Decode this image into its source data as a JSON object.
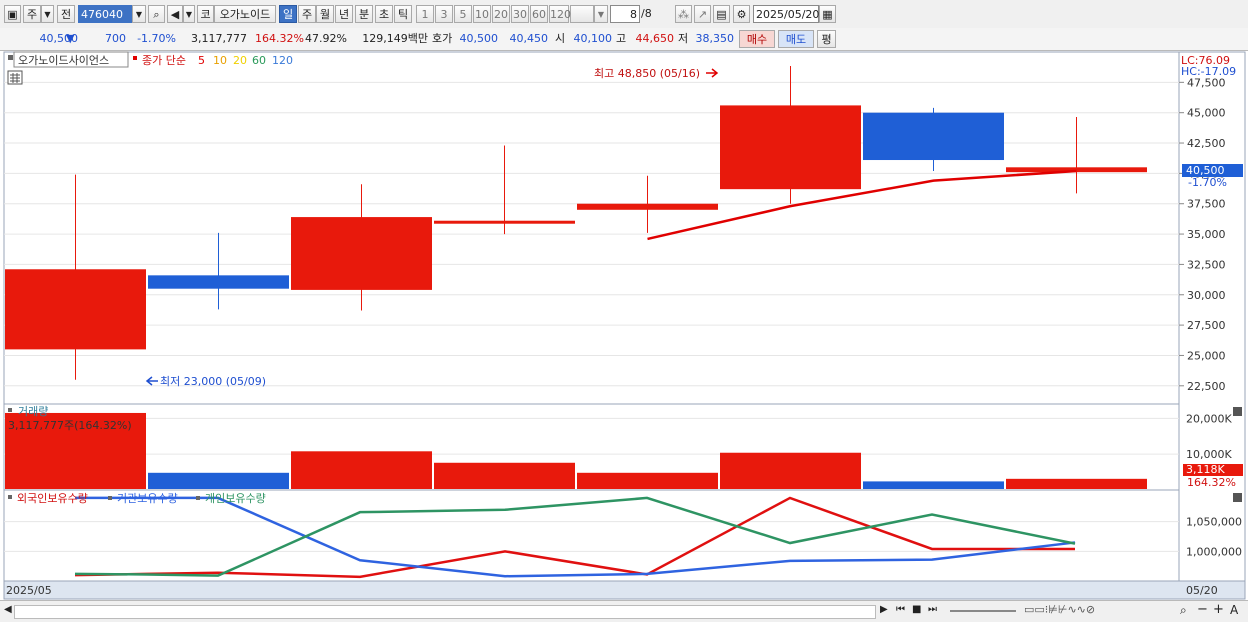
{
  "toolbar": {
    "market_label": "주",
    "prev_label": "전",
    "stock_code": "476040",
    "type_label": "코",
    "stock_name": "오가노이드",
    "periods": [
      "일",
      "주",
      "월",
      "년",
      "분",
      "초",
      "틱"
    ],
    "active_period": "일",
    "intervals": [
      "1",
      "3",
      "5",
      "10",
      "20",
      "30",
      "60",
      "120"
    ],
    "count_value": "8",
    "count_total": "/8",
    "date": "2025/05/20"
  },
  "quote": {
    "price": "40,500",
    "change": "700",
    "change_pct": "-1.70%",
    "volume": "3,117,777",
    "volume_ratio": "164.32%",
    "turnover": "47.92%",
    "amount": "129,149백만",
    "ask_label": "호가",
    "ask": "40,500",
    "bid": "40,450",
    "open_label": "시",
    "open": "40,100",
    "high_label": "고",
    "high": "44,650",
    "low_label": "저",
    "low": "38,350",
    "buy_label": "매수",
    "sell_label": "매도",
    "eval_label": "평"
  },
  "legend": {
    "name": "오가노이드사이언스",
    "ma_prefix": "종가 단순",
    "ma": [
      {
        "label": "5",
        "color": "#e00000"
      },
      {
        "label": "10",
        "color": "#e8a000"
      },
      {
        "label": "20",
        "color": "#f0d000"
      },
      {
        "label": "60",
        "color": "#2a9a5a"
      },
      {
        "label": "120",
        "color": "#3a7ad8"
      }
    ]
  },
  "price_panel": {
    "lc": "LC:76.09",
    "hc": "HC:-17.09",
    "current_price": "40,500",
    "current_pct": "-1.70%",
    "high_note": "최고 48,850 (05/16)",
    "low_note": "최저 23,000 (05/09)"
  },
  "volume_panel": {
    "title": "거래량",
    "note": "3,117,777주(164.32%)",
    "current": "3,118K",
    "current_pct": "164.32%"
  },
  "holdings_panel": {
    "series_labels": [
      "외국인보유수량",
      "기관보유수량",
      "개인보유수량"
    ]
  },
  "xaxis": {
    "left_label": "2025/05",
    "right_label": "05/20"
  },
  "colors": {
    "up": "#e8190c",
    "down": "#1f5fd6",
    "ma5": "#e00000",
    "foreign": "#e01010",
    "inst": "#2f63e0",
    "indiv": "#2e9463"
  },
  "chart_data": [
    {
      "type": "candlestick",
      "title": "",
      "ylim": [
        21000,
        50000
      ],
      "y_ticks": [
        "47,500",
        "45,000",
        "42,500",
        "40,000",
        "37,500",
        "35,000",
        "32,500",
        "30,000",
        "27,500",
        "25,000",
        "22,500"
      ],
      "y_tick_values": [
        47500,
        45000,
        42500,
        40000,
        37500,
        35000,
        32500,
        30000,
        27500,
        25000,
        22500
      ],
      "candles": [
        {
          "open": 25500,
          "close": 32100,
          "high": 39900,
          "low": 23000,
          "dir": "up"
        },
        {
          "open": 31600,
          "close": 30500,
          "high": 35100,
          "low": 28800,
          "dir": "down"
        },
        {
          "open": 30400,
          "close": 36400,
          "high": 39100,
          "low": 28700,
          "dir": "up"
        },
        {
          "open": 36000,
          "close": 36100,
          "high": 42300,
          "low": 35000,
          "dir": "up"
        },
        {
          "open": 37000,
          "close": 37500,
          "high": 39800,
          "low": 35100,
          "dir": "up"
        },
        {
          "open": 38700,
          "close": 45600,
          "high": 48850,
          "low": 37500,
          "dir": "up"
        },
        {
          "open": 45000,
          "close": 41100,
          "high": 45400,
          "low": 40200,
          "dir": "down"
        },
        {
          "open": 40100,
          "close": 40500,
          "high": 44650,
          "low": 38350,
          "dir": "up"
        }
      ],
      "ma5": [
        null,
        null,
        null,
        null,
        34600,
        37300,
        39400,
        40200
      ]
    },
    {
      "type": "bar",
      "title": "거래량",
      "unit": "K",
      "ylim": [
        0,
        24000
      ],
      "y_ticks": [
        "20,000K",
        "10,000K"
      ],
      "y_tick_values": [
        20000,
        10000
      ],
      "values": [
        21500,
        4800,
        10800,
        7600,
        4800,
        10400,
        2400,
        3118
      ],
      "dirs": [
        "up",
        "down",
        "up",
        "up",
        "up",
        "up",
        "down",
        "up"
      ]
    },
    {
      "type": "line",
      "ylim": [
        950000,
        1100000
      ],
      "y_ticks": [
        "1,050,000",
        "1,000,000"
      ],
      "y_tick_values": [
        1050000,
        1000000
      ],
      "series": [
        {
          "name": "외국인보유수량",
          "color": "#e01010",
          "values": [
            960000,
            962000,
            964000,
            957000,
            1000000,
            961000,
            1090000,
            1004000,
            1004000
          ]
        },
        {
          "name": "기관보유수량",
          "color": "#2f63e0",
          "values": [
            1090000,
            1090000,
            1090000,
            985000,
            958000,
            962000,
            984000,
            986000,
            1015000
          ]
        },
        {
          "name": "개인보유수량",
          "color": "#2e9463",
          "values": [
            962000,
            961000,
            959000,
            1066000,
            1070000,
            1090000,
            1014000,
            1062000,
            1013000
          ]
        }
      ]
    }
  ]
}
